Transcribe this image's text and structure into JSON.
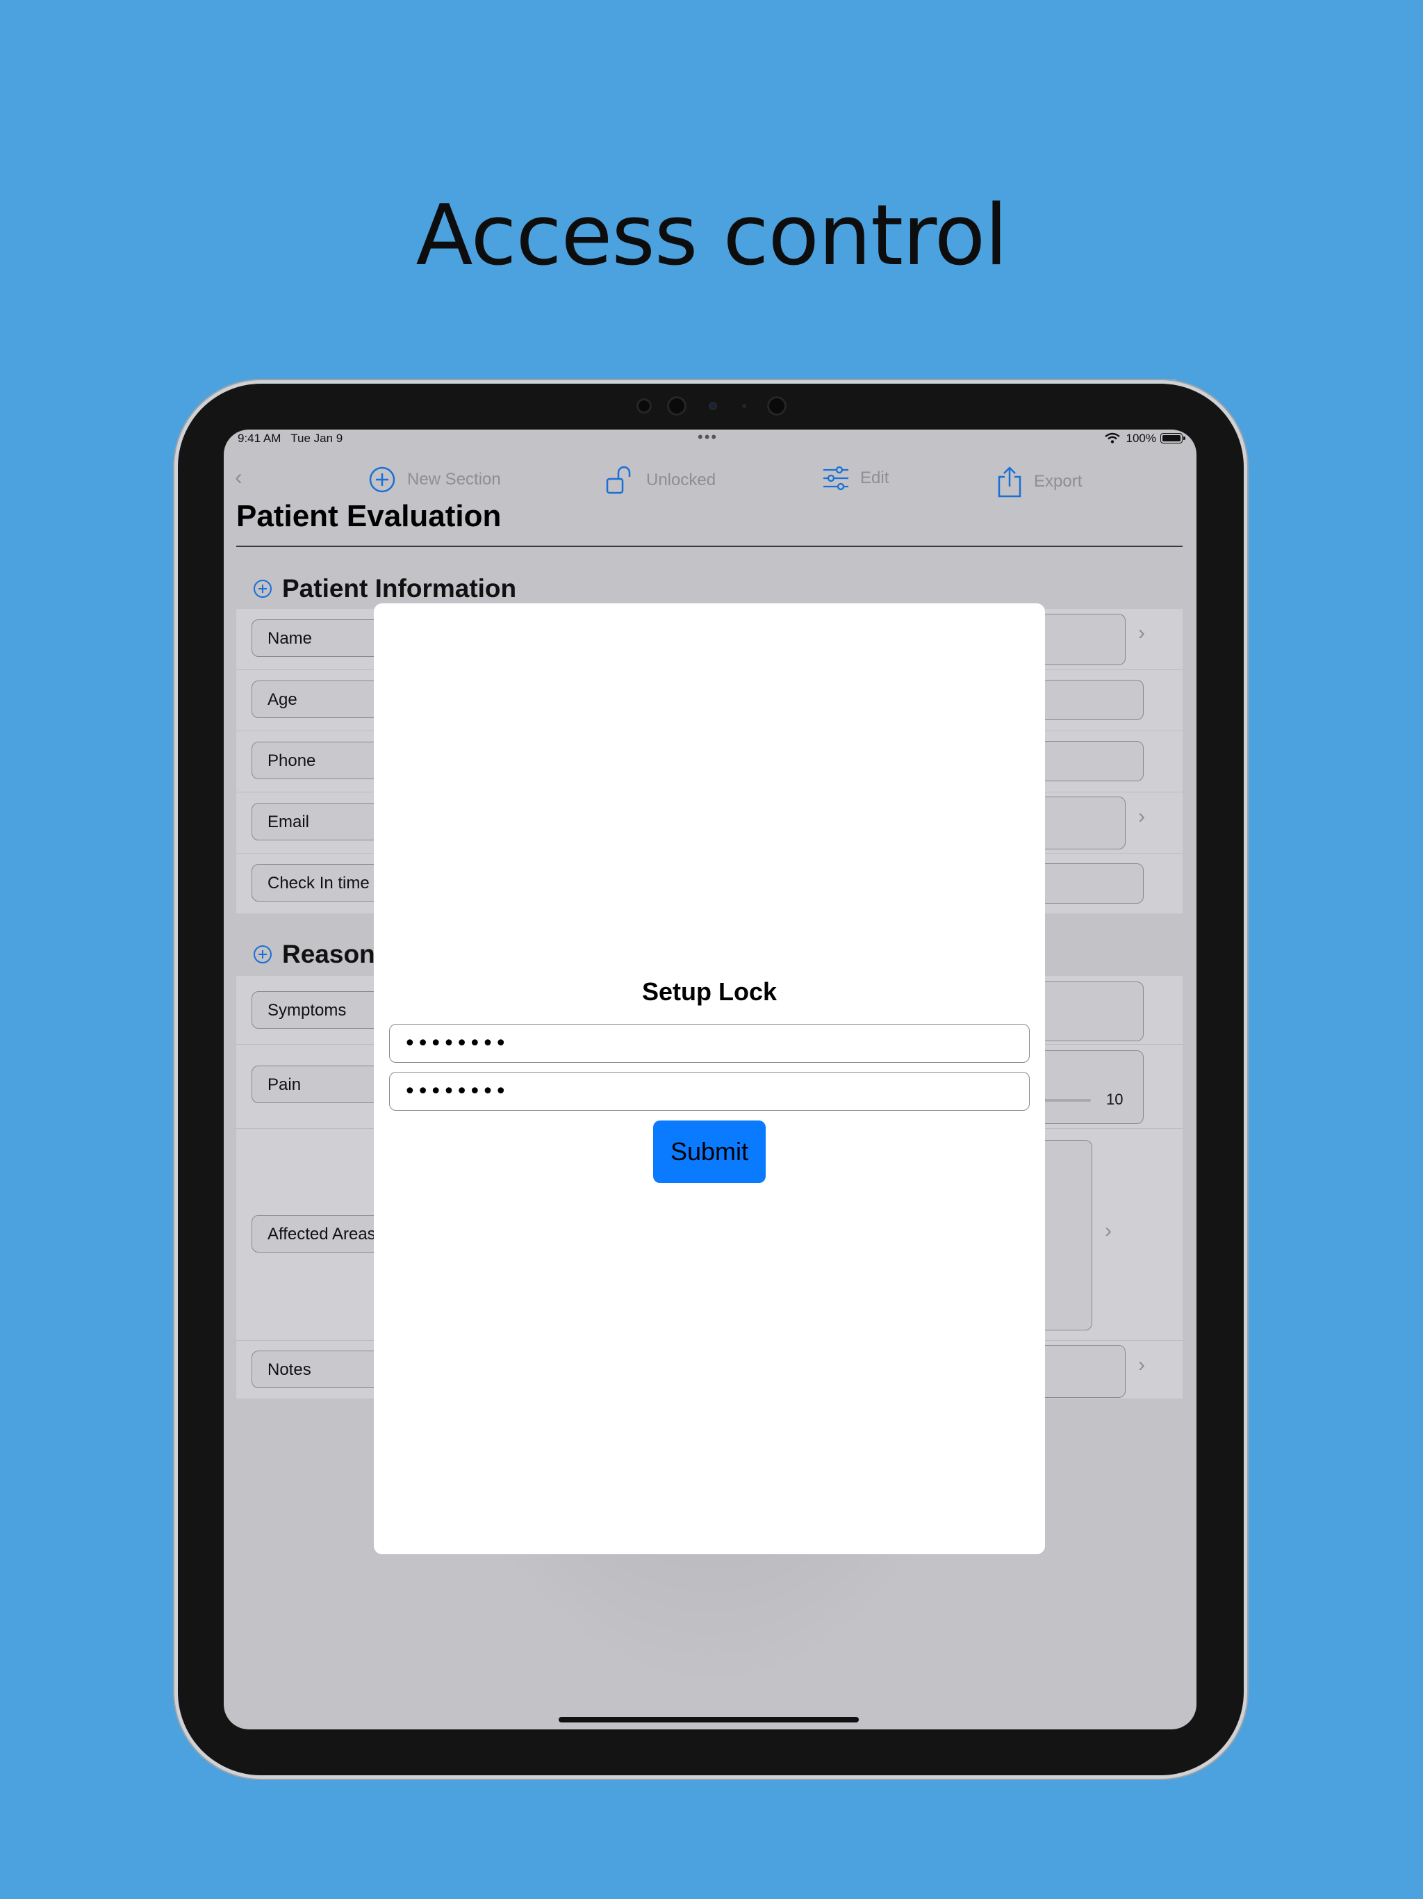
{
  "headline": "Access control",
  "status_bar": {
    "time": "9:41 AM",
    "date": "Tue Jan 9",
    "battery": "100%"
  },
  "toolbar": {
    "new_section": "New Section",
    "lock_state": "Unlocked",
    "edit": "Edit",
    "export": "Export"
  },
  "page_title": "Patient Evaluation",
  "sections": {
    "patient_info": {
      "title": "Patient Information",
      "fields": [
        "Name",
        "Age",
        "Phone",
        "Email",
        "Check In time"
      ]
    },
    "reason": {
      "title": "Reason",
      "fields": [
        "Symptoms",
        "Pain",
        "Affected Areas",
        "Notes"
      ],
      "pain_max": "10"
    }
  },
  "modal": {
    "title": "Setup Lock",
    "password_value": "••••••••",
    "confirm_value": "••••••••",
    "submit_label": "Submit"
  },
  "colors": {
    "background": "#4ca2de",
    "accent": "#0a7aff",
    "icon_blue": "#1a6fd6"
  }
}
